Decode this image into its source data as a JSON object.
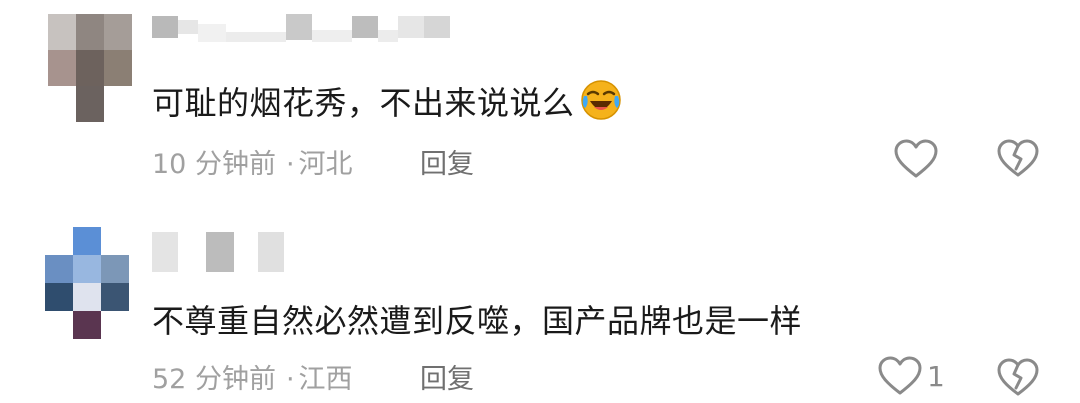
{
  "comments": [
    {
      "text": "可耻的烟花秀，不出来说说么",
      "emoji": "laughing-crying-emoji",
      "time": "10 分钟前",
      "separator": "·",
      "location": "河北",
      "reply_label": "回复",
      "like_count": ""
    },
    {
      "text": "不尊重自然必然遭到反噬，国产品牌也是一样",
      "time": "52 分钟前",
      "separator": "·",
      "location": "江西",
      "reply_label": "回复",
      "like_count": "1"
    }
  ],
  "icons": {
    "like": "heart-outline-icon",
    "dislike": "broken-heart-icon"
  },
  "colors": {
    "text": "#1a1a1a",
    "meta": "#a0a0a0",
    "reply": "#707070",
    "icon": "#8a8a8a",
    "emoji": "#f5b21b"
  }
}
